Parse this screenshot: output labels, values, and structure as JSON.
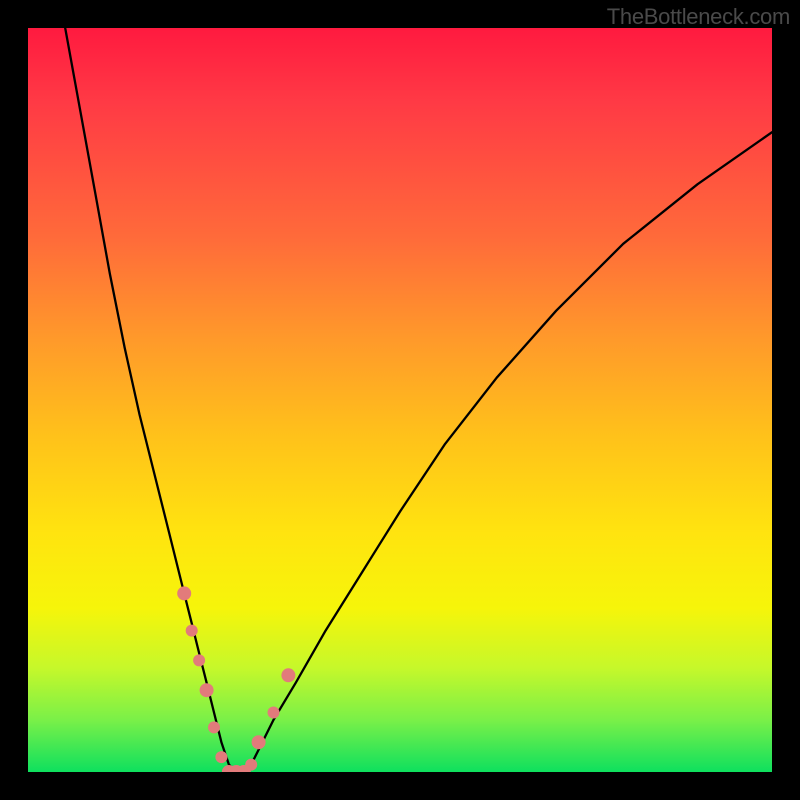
{
  "watermark": "TheBottleneck.com",
  "chart_data": {
    "type": "line",
    "title": "",
    "xlabel": "",
    "ylabel": "",
    "xlim": [
      0,
      100
    ],
    "ylim": [
      0,
      100
    ],
    "series": [
      {
        "name": "bottleneck-curve",
        "x": [
          5,
          7,
          9,
          11,
          13,
          15,
          17,
          19,
          21,
          22,
          23,
          24,
          25,
          26,
          27,
          28,
          29,
          30,
          31,
          33,
          36,
          40,
          45,
          50,
          56,
          63,
          71,
          80,
          90,
          100
        ],
        "values": [
          100,
          89,
          78,
          67,
          57,
          48,
          40,
          32,
          24,
          20,
          16,
          12,
          8,
          4,
          1,
          0,
          0,
          1,
          3,
          7,
          12,
          19,
          27,
          35,
          44,
          53,
          62,
          71,
          79,
          86
        ]
      }
    ],
    "markers": {
      "name": "highlight-points",
      "color": "#e27b7b",
      "x": [
        21,
        22,
        23,
        24,
        25,
        26,
        27,
        28,
        29,
        30,
        31,
        33,
        35
      ],
      "values": [
        24,
        19,
        15,
        11,
        6,
        2,
        0,
        0,
        0,
        1,
        4,
        8,
        13
      ],
      "radius": [
        7,
        6,
        6,
        7,
        6,
        6,
        7,
        7,
        7,
        6,
        7,
        6,
        7
      ]
    },
    "gradient_stops": [
      {
        "pos": 0,
        "color": "#ff1a3f"
      },
      {
        "pos": 28,
        "color": "#ff6a3a"
      },
      {
        "pos": 55,
        "color": "#ffc21a"
      },
      {
        "pos": 78,
        "color": "#f6f50a"
      },
      {
        "pos": 100,
        "color": "#0ee05e"
      }
    ]
  }
}
